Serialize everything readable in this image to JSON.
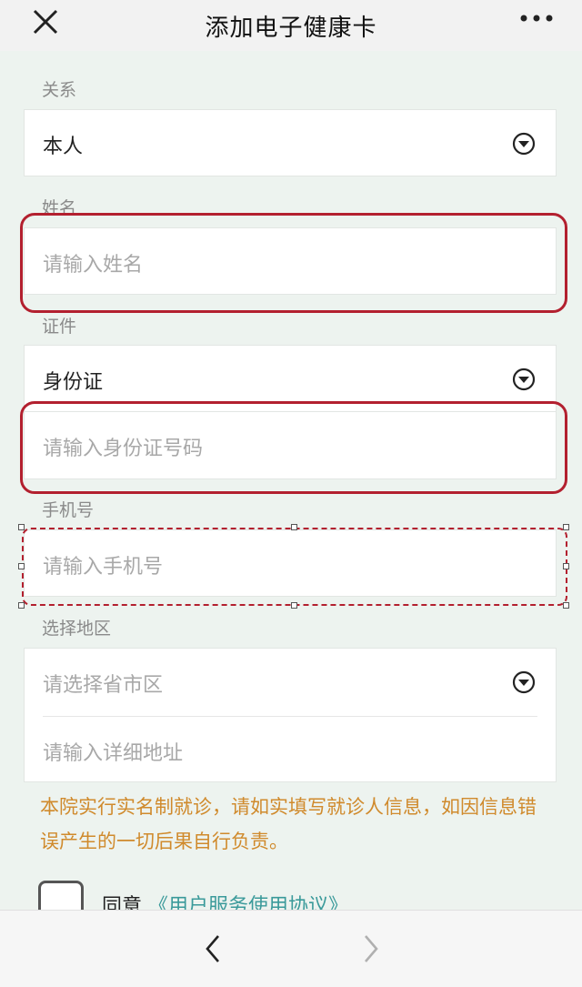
{
  "header": {
    "title": "添加电子健康卡",
    "close_icon": "close-icon",
    "more_icon": "more-icon"
  },
  "form": {
    "relation": {
      "label": "关系",
      "value": "本人"
    },
    "name": {
      "label": "姓名",
      "placeholder": "请输入姓名"
    },
    "id": {
      "label": "证件",
      "type_value": "身份证",
      "number_placeholder": "请输入身份证号码"
    },
    "phone": {
      "label": "手机号",
      "placeholder": "请输入手机号"
    },
    "region": {
      "label": "选择地区",
      "select_placeholder": "请选择省市区",
      "address_placeholder": "请输入详细地址"
    }
  },
  "notice": "本院实行实名制就诊，请如实填写就诊人信息，如因信息错误产生的一切后果自行负责。",
  "agreement": {
    "agree_label": "同意",
    "link_text": "《用户服务使用协议》"
  },
  "colors": {
    "highlight": "#b3202f",
    "notice": "#d08a2c",
    "link": "#3a9a9a"
  },
  "bottom_nav": {
    "back_icon": "chevron-left-icon",
    "forward_icon": "chevron-right-icon"
  }
}
